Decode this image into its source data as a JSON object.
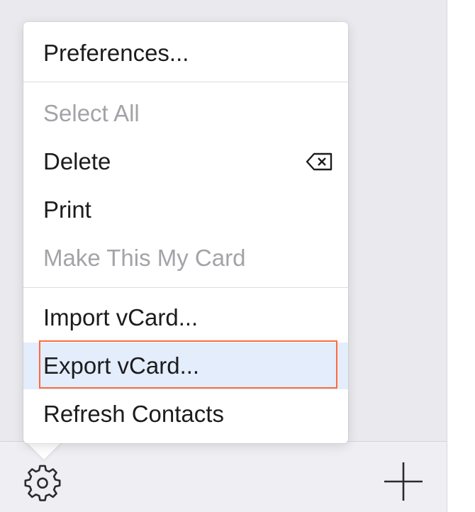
{
  "menu": {
    "items": [
      {
        "label": "Preferences...",
        "enabled": true
      },
      {
        "label": "Select All",
        "enabled": false
      },
      {
        "label": "Delete",
        "enabled": true,
        "shortcut_icon": "delete-key-icon"
      },
      {
        "label": "Print",
        "enabled": true
      },
      {
        "label": "Make This My Card",
        "enabled": false
      },
      {
        "label": "Import vCard...",
        "enabled": true
      },
      {
        "label": "Export vCard...",
        "enabled": true,
        "highlighted": true
      },
      {
        "label": "Refresh Contacts",
        "enabled": true
      }
    ]
  },
  "toolbar": {
    "settings_icon": "gear-icon",
    "add_icon": "plus-icon"
  },
  "colors": {
    "highlight_background": "#e4edfb",
    "highlight_outline": "#ff6a3d",
    "disabled_text": "#a3a3a8",
    "text": "#1c1c1e"
  }
}
